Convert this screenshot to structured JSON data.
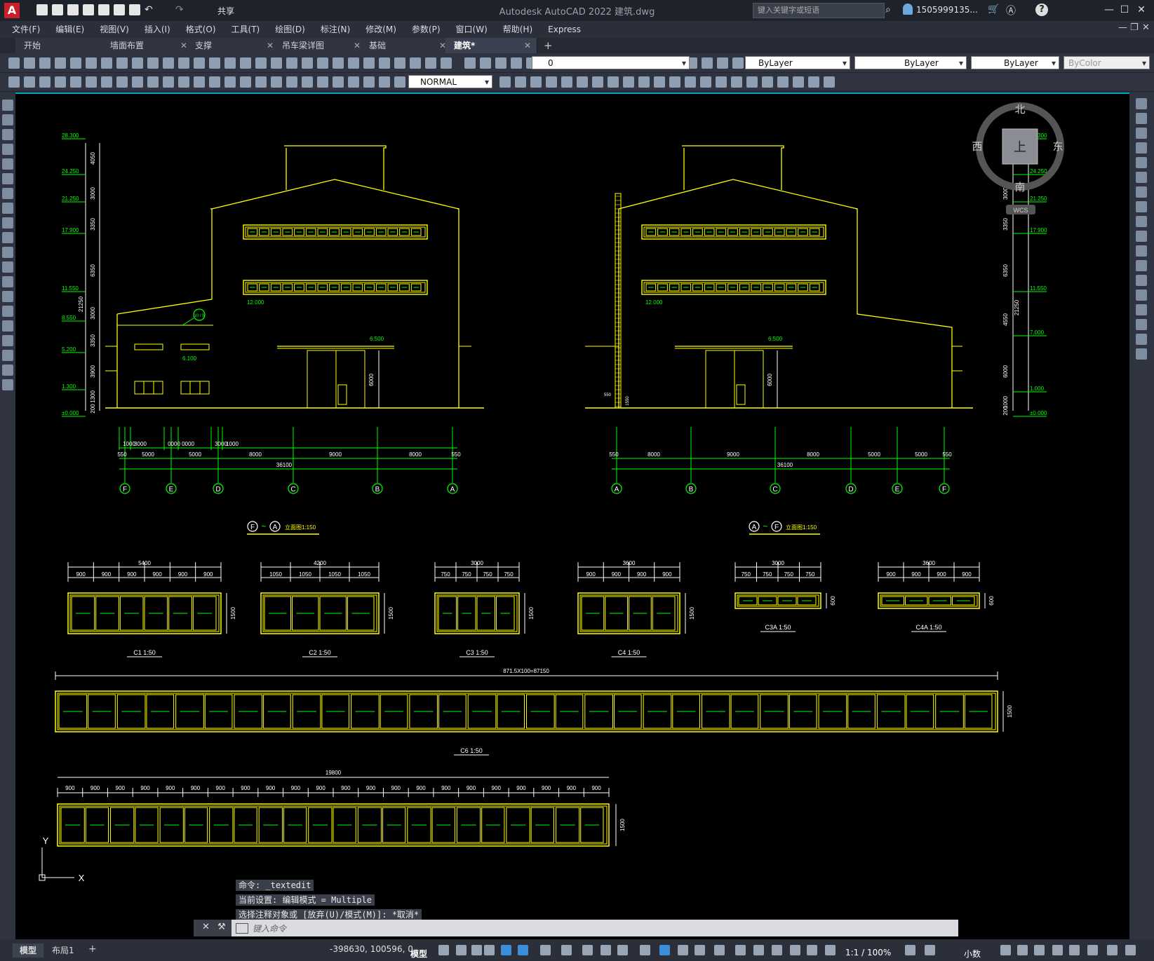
{
  "app": {
    "title": "Autodesk AutoCAD 2022   建筑.dwg",
    "logo": "A",
    "share": "共享"
  },
  "search": {
    "placeholder": "键入关键字或短语"
  },
  "user": {
    "name": "1505999135..."
  },
  "menu": [
    "文件(F)",
    "编辑(E)",
    "视图(V)",
    "插入(I)",
    "格式(O)",
    "工具(T)",
    "绘图(D)",
    "标注(N)",
    "修改(M)",
    "参数(P)",
    "窗口(W)",
    "帮助(H)",
    "Express"
  ],
  "tabs": [
    "开始",
    "墙面布置",
    "支撑",
    "吊车梁详图",
    "基础",
    "建筑*"
  ],
  "layer": {
    "current": "0"
  },
  "props": {
    "color": "ByLayer",
    "linetype": "ByLayer",
    "lineweight": "ByLayer",
    "plotstyle": "ByColor"
  },
  "style": {
    "visual": "NORMAL"
  },
  "viewcube": {
    "north": "北",
    "south": "南",
    "east": "东",
    "west": "西",
    "top": "上",
    "wcs": "WCS"
  },
  "drawing": {
    "left_elev": {
      "title": "F~A立面图",
      "scale": "1:150",
      "circle_title_a": "F",
      "circle_title_b": "A",
      "levels": [
        "28.300",
        "24.250",
        "21.250",
        "17.900",
        "11.550",
        "8.550",
        "5.200",
        "1.300",
        "±0.000"
      ],
      "level_dims": [
        "4050",
        "3000",
        "3350",
        "6350",
        "3000",
        "3350",
        "3900",
        "1300",
        "200"
      ],
      "total_height": "21250",
      "marks": {
        "canopy": "6.500",
        "window": "12.000",
        "side": "6.100",
        "door_height": "6000"
      },
      "bay_dims_top": [
        "1000",
        "3000",
        "0000",
        "0000",
        "3000",
        "1000"
      ],
      "bay_dims": [
        "550",
        "5000",
        "5000",
        "8000",
        "9000",
        "8000",
        "550"
      ],
      "total_width": "36100",
      "axes": [
        "F",
        "E",
        "D",
        "C",
        "B",
        "A"
      ],
      "detail_tag": "10 / 9"
    },
    "right_elev": {
      "title": "A~F立面图",
      "scale": "1:150",
      "circle_title_a": "A",
      "circle_title_b": "F",
      "levels": [
        "28.300",
        "24.250",
        "21.250",
        "17.900",
        "11.550",
        "7.000",
        "1.000",
        "±0.000"
      ],
      "level_dims": [
        "4050",
        "3000",
        "3350",
        "6350",
        "4550",
        "6000",
        "1000",
        "200"
      ],
      "total_height": "21250",
      "marks": {
        "canopy": "6.500",
        "window": "12.000",
        "door_height": "6000",
        "small_a": "550",
        "small_b": "1550"
      },
      "bay_dims": [
        "550",
        "8000",
        "9000",
        "8000",
        "5000",
        "5000",
        "550"
      ],
      "total_width": "36100",
      "axes": [
        "A",
        "B",
        "C",
        "D",
        "E",
        "F"
      ]
    },
    "windows": [
      {
        "name": "C1",
        "scale": "1:50",
        "total": "5400",
        "parts": [
          "900",
          "900",
          "900",
          "900",
          "900",
          "900"
        ],
        "height": "1500"
      },
      {
        "name": "C2",
        "scale": "1:50",
        "total": "4200",
        "parts": [
          "1050",
          "1050",
          "1050",
          "1050"
        ],
        "height": "1500"
      },
      {
        "name": "C3",
        "scale": "1:50",
        "total": "3000",
        "parts": [
          "750",
          "750",
          "750",
          "750"
        ],
        "height": "1500"
      },
      {
        "name": "C4",
        "scale": "1:50",
        "total": "3600",
        "parts": [
          "900",
          "900",
          "900",
          "900"
        ],
        "height": "1500"
      },
      {
        "name": "C3A",
        "scale": "1:50",
        "total": "3000",
        "parts": [
          "750",
          "750",
          "750",
          "750"
        ],
        "height": "600"
      },
      {
        "name": "C4A",
        "scale": "1:50",
        "total": "3600",
        "parts": [
          "900",
          "900",
          "900",
          "900"
        ],
        "height": "600"
      }
    ],
    "c6": {
      "name": "C6",
      "scale": "1:50",
      "total": "871.5X100=87150",
      "height": "1500",
      "panes": 16
    },
    "c7": {
      "total": "19800",
      "part": "900",
      "parts_count": 22,
      "height": "1500",
      "panes": 11
    },
    "ucs": {
      "x": "X",
      "y": "Y"
    }
  },
  "command": {
    "history": [
      "命令: _textedit",
      "当前设置: 编辑模式 = Multiple",
      "选择注释对象或 [放弃(U)/模式(M)]: *取消*"
    ],
    "placeholder": "键入命令"
  },
  "status": {
    "layout_tabs": [
      "模型",
      "布局1"
    ],
    "coords": "-398630, 100596, 0",
    "mode": "模型",
    "scale": "1:1 / 100%",
    "units": "小数"
  },
  "colors": {
    "yellow": "#ffff00",
    "green": "#00ff00",
    "white": "#ffffff",
    "canvas": "#000000",
    "accent": "#00a5b8"
  }
}
